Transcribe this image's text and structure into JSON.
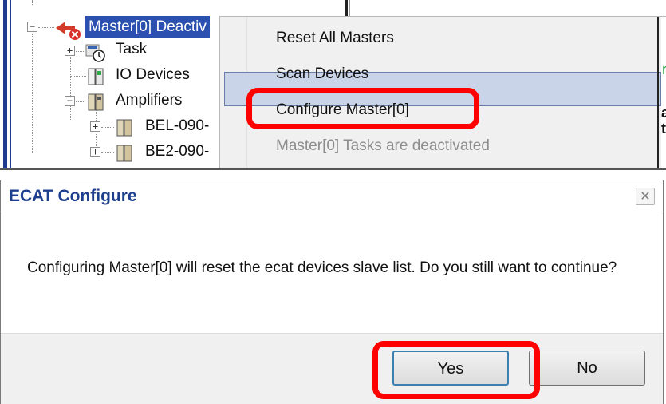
{
  "tree": {
    "master_node": "Master[0] Deactiv",
    "items": [
      {
        "label": "Task"
      },
      {
        "label": "IO Devices"
      },
      {
        "label": "Amplifiers"
      },
      {
        "label": "BEL-090-"
      },
      {
        "label": "BE2-090-"
      }
    ]
  },
  "context_menu": {
    "items": [
      {
        "label": "Reset All Masters",
        "disabled": false
      },
      {
        "label": "Scan Devices",
        "disabled": false
      },
      {
        "label": "Configure Master[0]",
        "disabled": false,
        "highlighted": true
      },
      {
        "label": "Master[0] Tasks are deactivated",
        "disabled": true
      }
    ],
    "right_edge_fragments": [
      "r",
      "a",
      "t"
    ]
  },
  "dialog": {
    "title": "ECAT Configure",
    "close_label": "✕",
    "message": "Configuring Master[0] will reset the ecat devices slave list. Do you still want to continue?",
    "buttons": {
      "yes": "Yes",
      "no": "No"
    }
  },
  "colors": {
    "highlight_frame": "#ff0000",
    "selection": "#2b50b0",
    "title_text": "#1e3f8e"
  }
}
